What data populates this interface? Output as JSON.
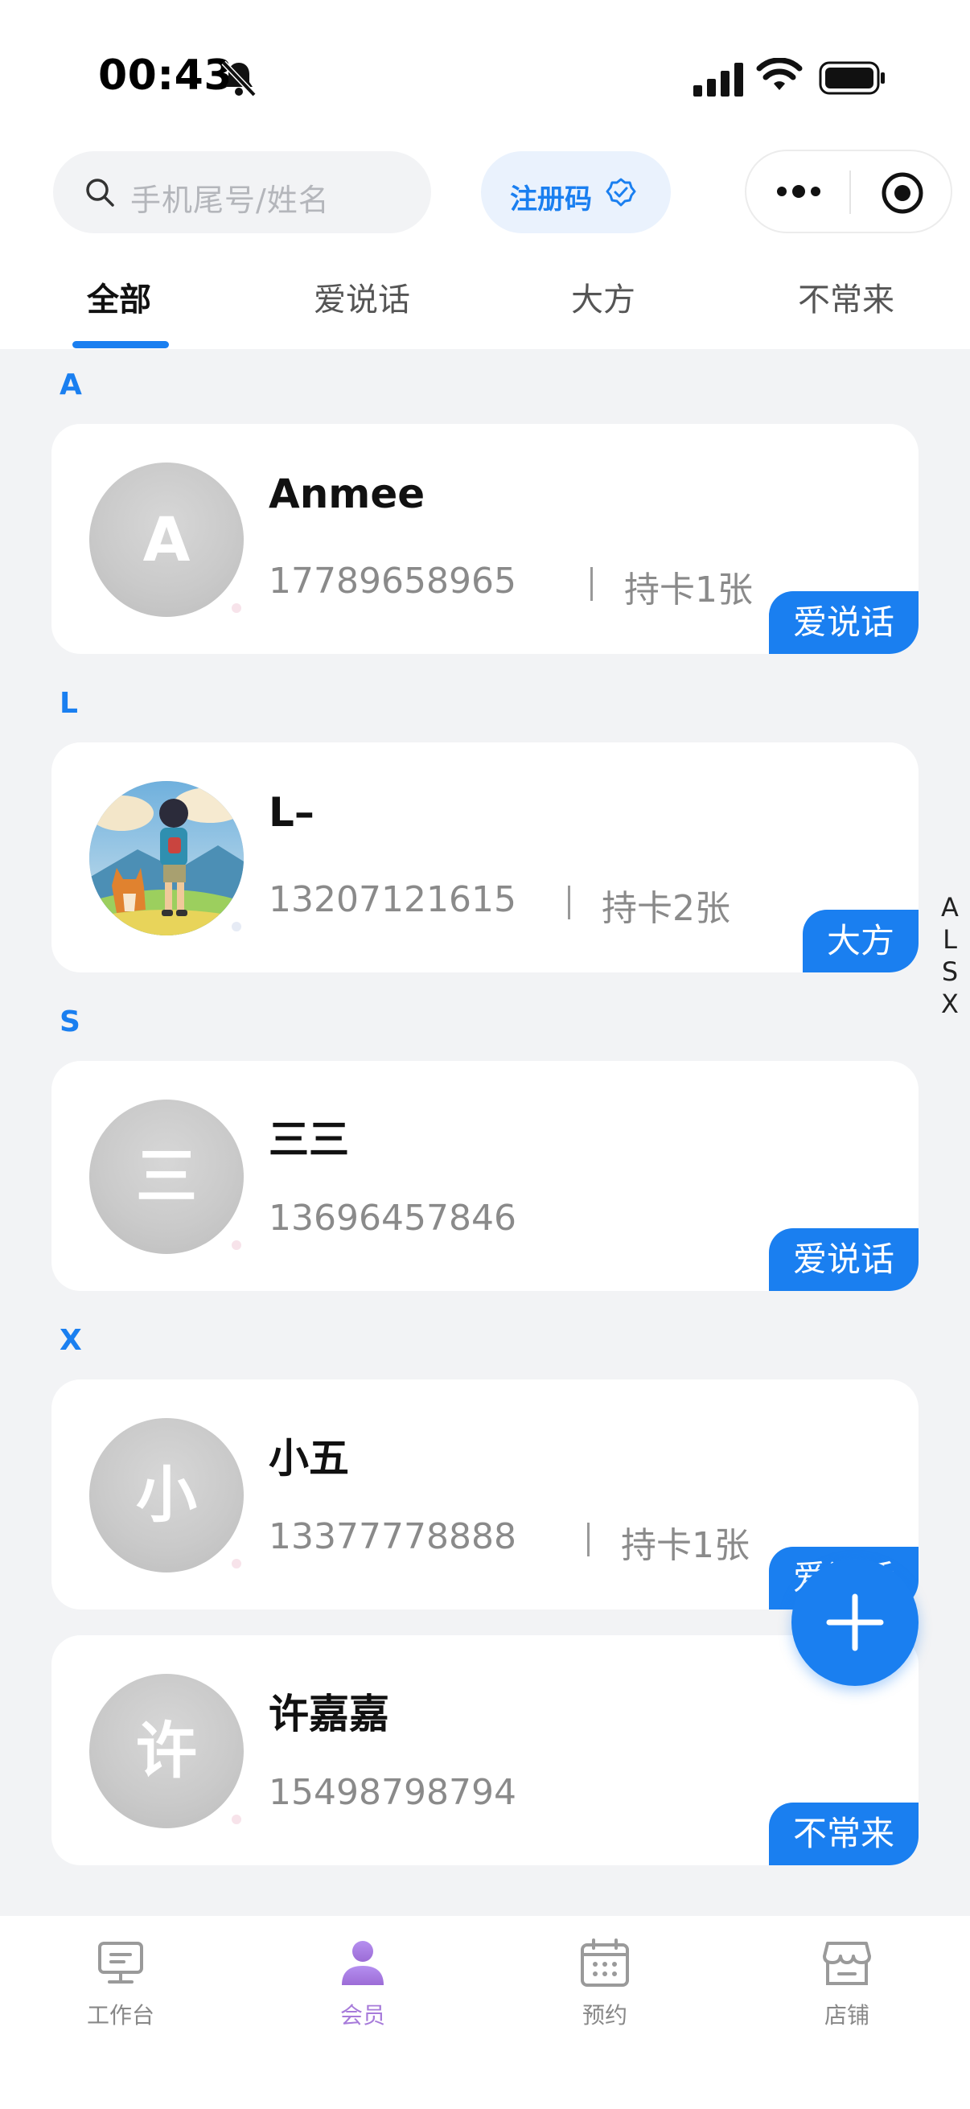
{
  "status_bar": {
    "time": "00:43"
  },
  "header": {
    "search_placeholder": "手机尾号/姓名",
    "register_code_label": "注册码"
  },
  "tabs": [
    {
      "label": "全部",
      "active": true
    },
    {
      "label": "爱说话",
      "active": false
    },
    {
      "label": "大方",
      "active": false
    },
    {
      "label": "不常来",
      "active": false
    }
  ],
  "sections": [
    {
      "letter": "A"
    },
    {
      "letter": "L"
    },
    {
      "letter": "S"
    },
    {
      "letter": "X"
    }
  ],
  "members": [
    {
      "avatar_text": "A",
      "name": "Anmee",
      "phone": "17789658965",
      "cards": "持卡1张",
      "tag": "爱说话",
      "status_dot_color": "#f7e3ea"
    },
    {
      "avatar_text": "",
      "name": "L–",
      "phone": "13207121615",
      "cards": "持卡2张",
      "tag": "大方",
      "status_dot_color": "#e6ebf5"
    },
    {
      "avatar_text": "三",
      "name": "三三",
      "phone": "13696457846",
      "cards": "",
      "tag": "爱说话",
      "status_dot_color": "#f7e3ea"
    },
    {
      "avatar_text": "小",
      "name": "小五",
      "phone": "13377778888",
      "cards": "持卡1张",
      "tag": "爱说话",
      "status_dot_color": "#f7e3ea"
    },
    {
      "avatar_text": "许",
      "name": "许嘉嘉",
      "phone": "15498798794",
      "cards": "",
      "tag": "不常来",
      "status_dot_color": "#f7e3ea"
    }
  ],
  "index_bar": [
    "A",
    "L",
    "S",
    "X"
  ],
  "tabbar": [
    {
      "label": "工作台",
      "icon": "monitor-icon",
      "active": false
    },
    {
      "label": "会员",
      "icon": "person-icon",
      "active": true
    },
    {
      "label": "预约",
      "icon": "calendar-icon",
      "active": false
    },
    {
      "label": "店铺",
      "icon": "store-icon",
      "active": false
    }
  ],
  "colors": {
    "accent": "#1a7ff0",
    "active_tab": "#a77bda",
    "background": "#f2f3f5"
  }
}
